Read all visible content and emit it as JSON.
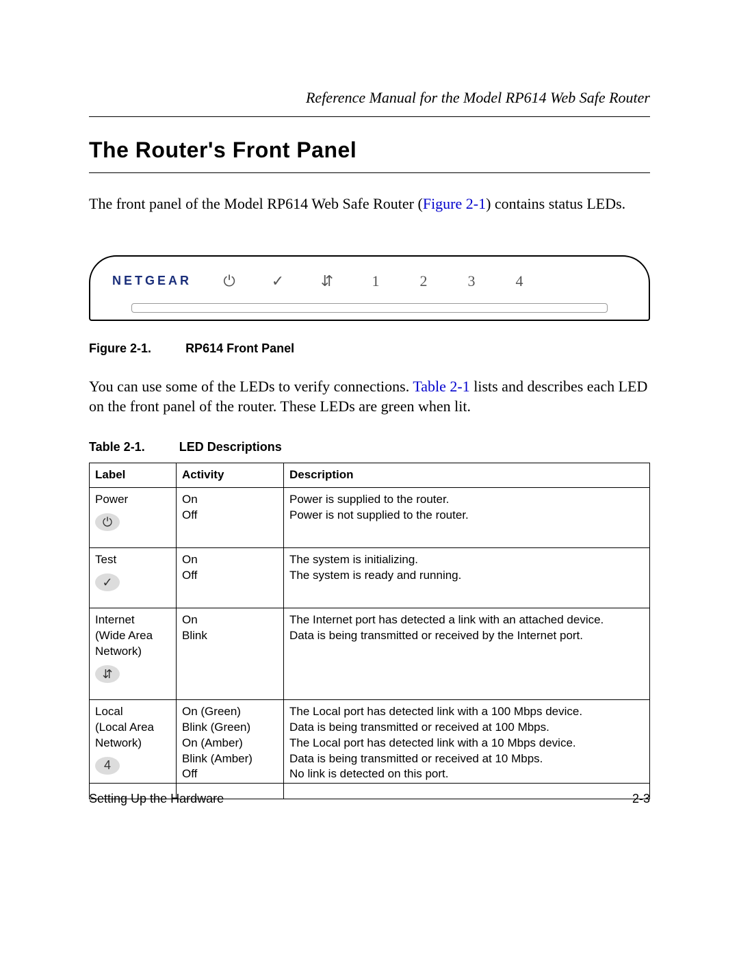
{
  "header": {
    "running_title": "Reference Manual for the Model RP614 Web Safe Router"
  },
  "section": {
    "title": "The Router's Front Panel"
  },
  "intro": {
    "pre": "The front panel of the Model RP614 Web Safe Router (",
    "xref": "Figure 2-1",
    "post": ") contains status LEDs."
  },
  "figure": {
    "brand": "NETGEAR",
    "panel_glyphs": [
      "⏻",
      "✓",
      "⇵",
      "1",
      "2",
      "3",
      "4"
    ],
    "caption_num": "Figure 2-1.",
    "caption_text": "RP614 Front Panel"
  },
  "mid_para": {
    "pre": "You can use some of the LEDs to verify connections. ",
    "xref": "Table 2-1",
    "post": " lists and describes each LED on the front panel of the router. These LEDs are green when lit."
  },
  "table": {
    "caption_num": "Table 2-1.",
    "caption_text": "LED Descriptions",
    "headers": {
      "label": "Label",
      "activity": "Activity",
      "description": "Description"
    },
    "rows": [
      {
        "label_lines": [
          "Power"
        ],
        "icon_glyph": "⏻",
        "activity_lines": [
          "On",
          "Off"
        ],
        "desc_lines": [
          "Power is supplied to the router.",
          "Power is not supplied to the router."
        ]
      },
      {
        "label_lines": [
          "Test"
        ],
        "icon_glyph": "✓",
        "activity_lines": [
          "On",
          "Off"
        ],
        "desc_lines": [
          "The system is initializing.",
          "The system is ready and running."
        ]
      },
      {
        "label_lines": [
          "Internet",
          "(Wide Area",
          "Network)"
        ],
        "icon_glyph": "⇵",
        "activity_lines": [
          "On",
          "Blink"
        ],
        "desc_lines": [
          "The Internet port has detected a link with an attached device.",
          "Data is being transmitted or received by the Internet port."
        ]
      },
      {
        "label_lines": [
          "Local",
          "(Local Area",
          "Network)"
        ],
        "icon_glyph": "4",
        "activity_lines": [
          "On (Green)",
          "Blink (Green)",
          "On (Amber)",
          "Blink (Amber)",
          "Off"
        ],
        "desc_lines": [
          "The Local port has detected link with a 100 Mbps device.",
          "Data is being transmitted or received at 100 Mbps.",
          "The Local port has detected link with a 10 Mbps device.",
          "Data is being transmitted or received at 10 Mbps.",
          "No link is detected on this port."
        ]
      }
    ]
  },
  "footer": {
    "left": "Setting Up the Hardware",
    "right": "2-3"
  }
}
